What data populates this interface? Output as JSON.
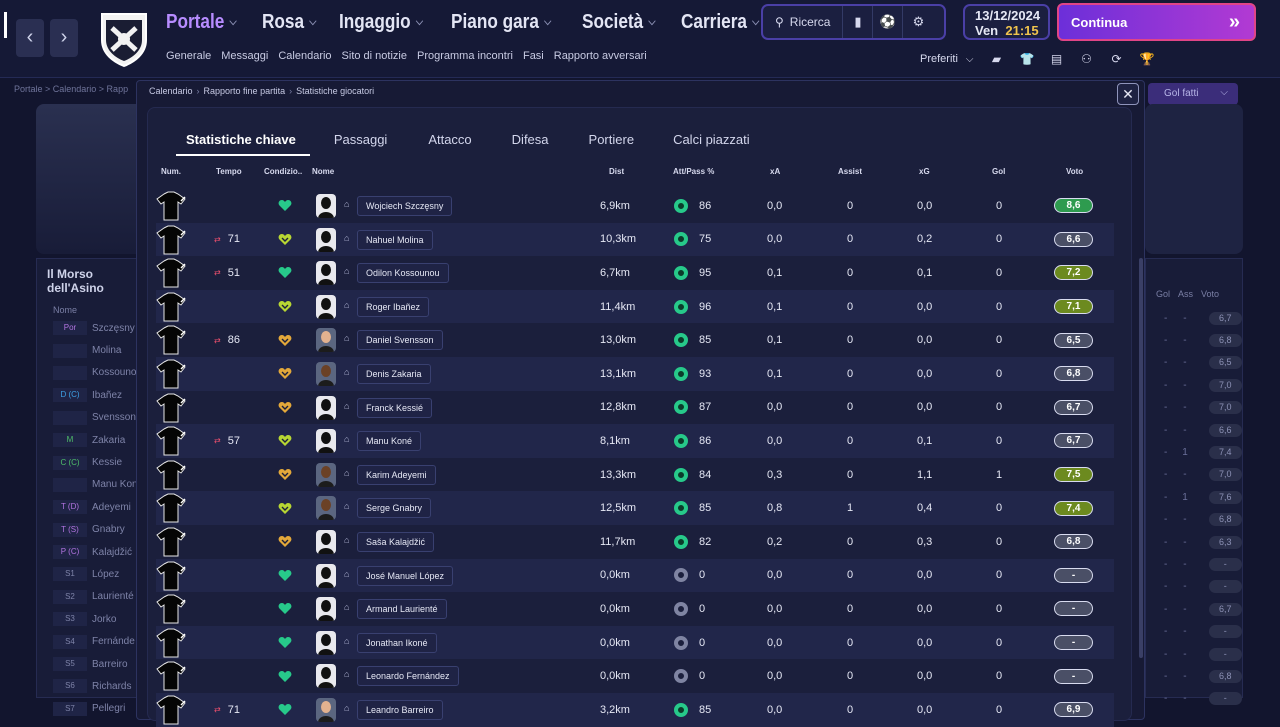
{
  "topbar": {
    "menus": [
      {
        "label": "Portale",
        "active": true
      },
      {
        "label": "Rosa",
        "active": false
      },
      {
        "label": "Ingaggio",
        "active": false
      },
      {
        "label": "Piano gara",
        "active": false
      },
      {
        "label": "Società",
        "active": false
      },
      {
        "label": "Carriera",
        "active": false
      }
    ],
    "submenu": [
      "Generale",
      "Messaggi",
      "Calendario",
      "Sito di notizie",
      "Programma incontri",
      "Fasi",
      "Rapporto avversari"
    ],
    "search_label": "Ricerca",
    "date": "13/12/2024",
    "day": "Ven",
    "time": "21:15",
    "continue_label": "Continua",
    "favorites_label": "Preferiti"
  },
  "background": {
    "breadcrumb": "Portale  >  Calendario  >  Rapp",
    "panel_title": "Il Morso dell'Asino",
    "panel_header": "Nome",
    "goals_filter": "Gol fatti",
    "right_headers": [
      "Gol",
      "Ass",
      "Voto"
    ],
    "rows": [
      {
        "pos": "Por",
        "name": "Szczęsny",
        "g": "-",
        "a": "-",
        "v": "6,7"
      },
      {
        "pos": "",
        "name": "Molina",
        "g": "-",
        "a": "-",
        "v": "6,8"
      },
      {
        "pos": "",
        "name": "Kossounou",
        "g": "-",
        "a": "-",
        "v": "6,5"
      },
      {
        "pos": "D (C)",
        "name": "Ibañez",
        "g": "-",
        "a": "-",
        "v": "7,0"
      },
      {
        "pos": "",
        "name": "Svensson",
        "g": "-",
        "a": "-",
        "v": "7,0"
      },
      {
        "pos": "M",
        "name": "Zakaria",
        "g": "-",
        "a": "-",
        "v": "6,6"
      },
      {
        "pos": "C (C)",
        "name": "Kessie",
        "g": "-",
        "a": "1",
        "v": "7,4"
      },
      {
        "pos": "",
        "name": "Manu Kon",
        "g": "-",
        "a": "-",
        "v": "7,0"
      },
      {
        "pos": "T (D)",
        "name": "Adeyemi",
        "g": "-",
        "a": "1",
        "v": "7,6"
      },
      {
        "pos": "T (S)",
        "name": "Gnabry",
        "g": "-",
        "a": "-",
        "v": "6,8"
      },
      {
        "pos": "P (C)",
        "name": "Kalajdžić",
        "g": "-",
        "a": "-",
        "v": "6,3"
      },
      {
        "pos": "S1",
        "name": "López",
        "g": "-",
        "a": "-",
        "v": "-"
      },
      {
        "pos": "S2",
        "name": "Laurienté",
        "g": "-",
        "a": "-",
        "v": "-"
      },
      {
        "pos": "S3",
        "name": "Jorko",
        "g": "-",
        "a": "-",
        "v": "6,7"
      },
      {
        "pos": "S4",
        "name": "Fernánde",
        "g": "-",
        "a": "-",
        "v": "-"
      },
      {
        "pos": "S5",
        "name": "Barreiro",
        "g": "-",
        "a": "-",
        "v": "-"
      },
      {
        "pos": "S6",
        "name": "Richards",
        "g": "-",
        "a": "-",
        "v": "6,8"
      },
      {
        "pos": "S7",
        "name": "Pellegri",
        "g": "-",
        "a": "-",
        "v": "-"
      }
    ]
  },
  "modal": {
    "breadcrumb": [
      "Calendario",
      "Rapporto fine partita",
      "Statistiche giocatori"
    ],
    "tabs": [
      {
        "label": "Statistiche chiave",
        "active": true
      },
      {
        "label": "Passaggi",
        "active": false
      },
      {
        "label": "Attacco",
        "active": false
      },
      {
        "label": "Difesa",
        "active": false
      },
      {
        "label": "Portiere",
        "active": false
      },
      {
        "label": "Calci piazzati",
        "active": false
      }
    ],
    "columns": {
      "num": "Num.",
      "tempo": "Tempo",
      "cond": "Condizio..",
      "nome": "Nome",
      "dist": "Dist",
      "pass": "Att/Pass %",
      "xa": "xA",
      "assist": "Assist",
      "xg": "xG",
      "gol": "Gol",
      "voto": "Voto"
    }
  },
  "players": [
    {
      "tempo": "",
      "subs": false,
      "cond": "green",
      "face": "silhouette",
      "name": "Wojciech Szczęsny",
      "dist": "6,9km",
      "pass": "86",
      "ring": true,
      "xa": "0,0",
      "assist": "0",
      "xg": "0,0",
      "gol": "0",
      "voto": "8,6",
      "vc": "#2e9b4f"
    },
    {
      "tempo": "71",
      "subs": true,
      "cond": "yellowgreen",
      "face": "silhouette",
      "name": "Nahuel Molina",
      "dist": "10,3km",
      "pass": "75",
      "ring": true,
      "xa": "0,0",
      "assist": "0",
      "xg": "0,2",
      "gol": "0",
      "voto": "6,6",
      "vc": "#4a4f66"
    },
    {
      "tempo": "51",
      "subs": true,
      "cond": "green",
      "face": "silhouette",
      "name": "Odilon Kossounou",
      "dist": "6,7km",
      "pass": "95",
      "ring": true,
      "xa": "0,1",
      "assist": "0",
      "xg": "0,1",
      "gol": "0",
      "voto": "7,2",
      "vc": "#6c8a1f"
    },
    {
      "tempo": "",
      "subs": false,
      "cond": "yellowgreen",
      "face": "silhouette",
      "name": "Roger Ibañez",
      "dist": "11,4km",
      "pass": "96",
      "ring": true,
      "xa": "0,1",
      "assist": "0",
      "xg": "0,0",
      "gol": "0",
      "voto": "7,1",
      "vc": "#6c8a1f"
    },
    {
      "tempo": "86",
      "subs": true,
      "cond": "orange",
      "face": "light",
      "name": "Daniel Svensson",
      "dist": "13,0km",
      "pass": "85",
      "ring": true,
      "xa": "0,1",
      "assist": "0",
      "xg": "0,0",
      "gol": "0",
      "voto": "6,5",
      "vc": "#4a4f66"
    },
    {
      "tempo": "",
      "subs": false,
      "cond": "orange",
      "face": "dark",
      "name": "Denis Zakaria",
      "dist": "13,1km",
      "pass": "93",
      "ring": true,
      "xa": "0,1",
      "assist": "0",
      "xg": "0,0",
      "gol": "0",
      "voto": "6,8",
      "vc": "#4a4f66"
    },
    {
      "tempo": "",
      "subs": false,
      "cond": "orange",
      "face": "silhouette",
      "name": "Franck Kessié",
      "dist": "12,8km",
      "pass": "87",
      "ring": true,
      "xa": "0,0",
      "assist": "0",
      "xg": "0,0",
      "gol": "0",
      "voto": "6,7",
      "vc": "#4a4f66"
    },
    {
      "tempo": "57",
      "subs": true,
      "cond": "yellowgreen",
      "face": "silhouette",
      "name": "Manu Koné",
      "dist": "8,1km",
      "pass": "86",
      "ring": true,
      "xa": "0,0",
      "assist": "0",
      "xg": "0,1",
      "gol": "0",
      "voto": "6,7",
      "vc": "#4a4f66"
    },
    {
      "tempo": "",
      "subs": false,
      "cond": "orange",
      "face": "dark",
      "name": "Karim Adeyemi",
      "dist": "13,3km",
      "pass": "84",
      "ring": true,
      "xa": "0,3",
      "assist": "0",
      "xg": "1,1",
      "gol": "1",
      "voto": "7,5",
      "vc": "#6c8a1f"
    },
    {
      "tempo": "",
      "subs": false,
      "cond": "yellowgreen",
      "face": "dark",
      "name": "Serge Gnabry",
      "dist": "12,5km",
      "pass": "85",
      "ring": true,
      "xa": "0,8",
      "assist": "1",
      "xg": "0,4",
      "gol": "0",
      "voto": "7,4",
      "vc": "#6c8a1f"
    },
    {
      "tempo": "",
      "subs": false,
      "cond": "orange",
      "face": "silhouette",
      "name": "Saša Kalajdžić",
      "dist": "11,7km",
      "pass": "82",
      "ring": true,
      "xa": "0,2",
      "assist": "0",
      "xg": "0,3",
      "gol": "0",
      "voto": "6,8",
      "vc": "#4a4f66"
    },
    {
      "tempo": "",
      "subs": false,
      "cond": "green",
      "face": "silhouette",
      "name": "José Manuel López",
      "dist": "0,0km",
      "pass": "0",
      "ring": false,
      "xa": "0,0",
      "assist": "0",
      "xg": "0,0",
      "gol": "0",
      "voto": "-",
      "vc": "#4a4f66"
    },
    {
      "tempo": "",
      "subs": false,
      "cond": "green",
      "face": "silhouette",
      "name": "Armand Laurienté",
      "dist": "0,0km",
      "pass": "0",
      "ring": false,
      "xa": "0,0",
      "assist": "0",
      "xg": "0,0",
      "gol": "0",
      "voto": "-",
      "vc": "#4a4f66"
    },
    {
      "tempo": "",
      "subs": false,
      "cond": "green",
      "face": "silhouette",
      "name": "Jonathan Ikoné",
      "dist": "0,0km",
      "pass": "0",
      "ring": false,
      "xa": "0,0",
      "assist": "0",
      "xg": "0,0",
      "gol": "0",
      "voto": "-",
      "vc": "#4a4f66"
    },
    {
      "tempo": "",
      "subs": false,
      "cond": "green",
      "face": "silhouette",
      "name": "Leonardo Fernández",
      "dist": "0,0km",
      "pass": "0",
      "ring": false,
      "xa": "0,0",
      "assist": "0",
      "xg": "0,0",
      "gol": "0",
      "voto": "-",
      "vc": "#4a4f66"
    },
    {
      "tempo": "71",
      "subs": true,
      "cond": "green",
      "face": "light",
      "name": "Leandro Barreiro",
      "dist": "3,2km",
      "pass": "85",
      "ring": true,
      "xa": "0,0",
      "assist": "0",
      "xg": "0,0",
      "gol": "0",
      "voto": "6,9",
      "vc": "#4a4f66"
    }
  ]
}
